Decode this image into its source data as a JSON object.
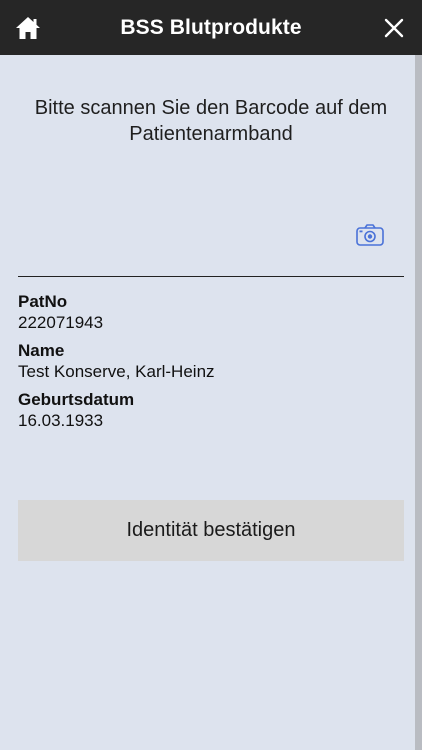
{
  "header": {
    "title": "BSS Blutprodukte",
    "home_icon": "home-icon",
    "close_icon": "close-icon"
  },
  "main": {
    "instruction": "Bitte scannen Sie den Barcode auf dem Patientenarmband",
    "camera_icon": "camera-icon",
    "fields": [
      {
        "label": "PatNo",
        "value": "222071943"
      },
      {
        "label": "Name",
        "value": "Test Konserve, Karl-Heinz"
      },
      {
        "label": "Geburtsdatum",
        "value": "16.03.1933"
      }
    ],
    "confirm_label": "Identität bestätigen"
  },
  "colors": {
    "topbar_bg": "#262626",
    "page_bg": "#dde3ee",
    "accent_icon": "#4a72d8",
    "button_bg": "#d7d7d7"
  }
}
